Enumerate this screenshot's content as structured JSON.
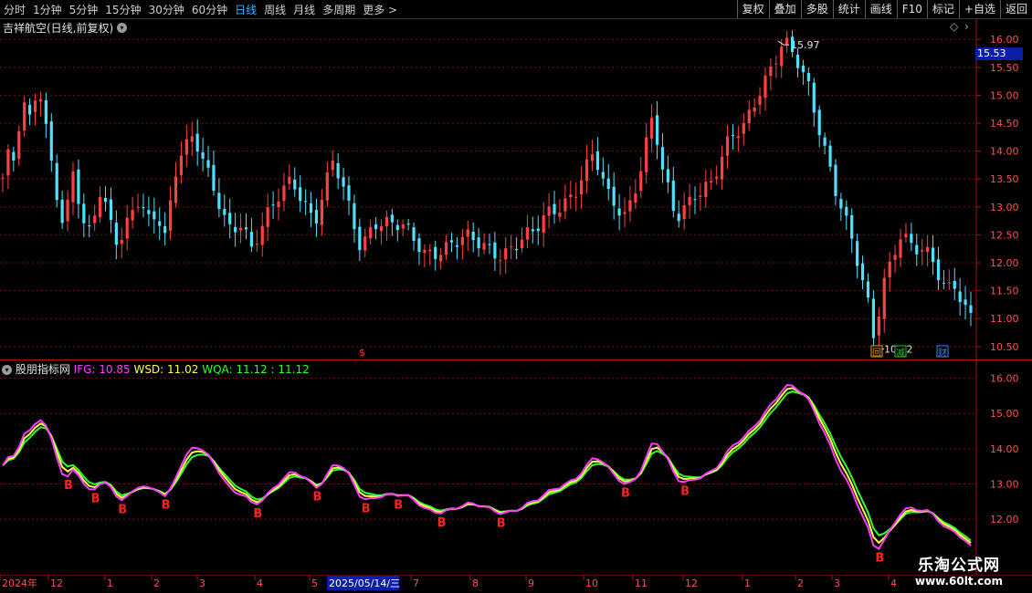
{
  "toolbar": {
    "left": [
      "分时",
      "1分钟",
      "5分钟",
      "15分钟",
      "30分钟",
      "60分钟",
      "日线",
      "周线",
      "月线",
      "多周期",
      "更多 >"
    ],
    "active": "日线",
    "right": [
      "复权",
      "叠加",
      "多股",
      "统计",
      "画线",
      "F10",
      "标记",
      "+自选",
      "返回"
    ]
  },
  "main": {
    "title": "吉祥航空(日线,前复权)",
    "high_label": "15.97",
    "low_label": "10.52",
    "current_price": "15.53",
    "s_marker": "$",
    "badges": [
      "回",
      "减",
      "财"
    ],
    "y_ticks": [
      "16.00",
      "15.50",
      "15.00",
      "14.50",
      "14.00",
      "13.50",
      "13.00",
      "12.50",
      "12.00",
      "11.50",
      "11.00",
      "10.50"
    ]
  },
  "indicator": {
    "name": "股朋指标网",
    "ifg_label": "IFG: 10.85",
    "wsd_label": "WSD: 11.02",
    "wqa_label": "WQA: 11.12 : 11.12",
    "y_ticks": [
      "16.00",
      "15.00",
      "14.00",
      "13.00",
      "12.00"
    ],
    "b_marker": "B",
    "colors": {
      "ifg": "#ff3cff",
      "wsd": "#ffff40",
      "wqa": "#30ff30",
      "up": "#ff4040",
      "down": "#50e0ff",
      "b": "#ff2020"
    }
  },
  "time_axis": {
    "labels": [
      "2024年",
      "12",
      "1",
      "2",
      "3",
      "4",
      "5",
      "2025/05/14/三",
      "7",
      "8",
      "9",
      "10",
      "11",
      "12",
      "1",
      "2",
      "3",
      "4"
    ]
  },
  "watermark": {
    "line1": "乐淘公式网",
    "line2": "www.60lt.com"
  }
}
